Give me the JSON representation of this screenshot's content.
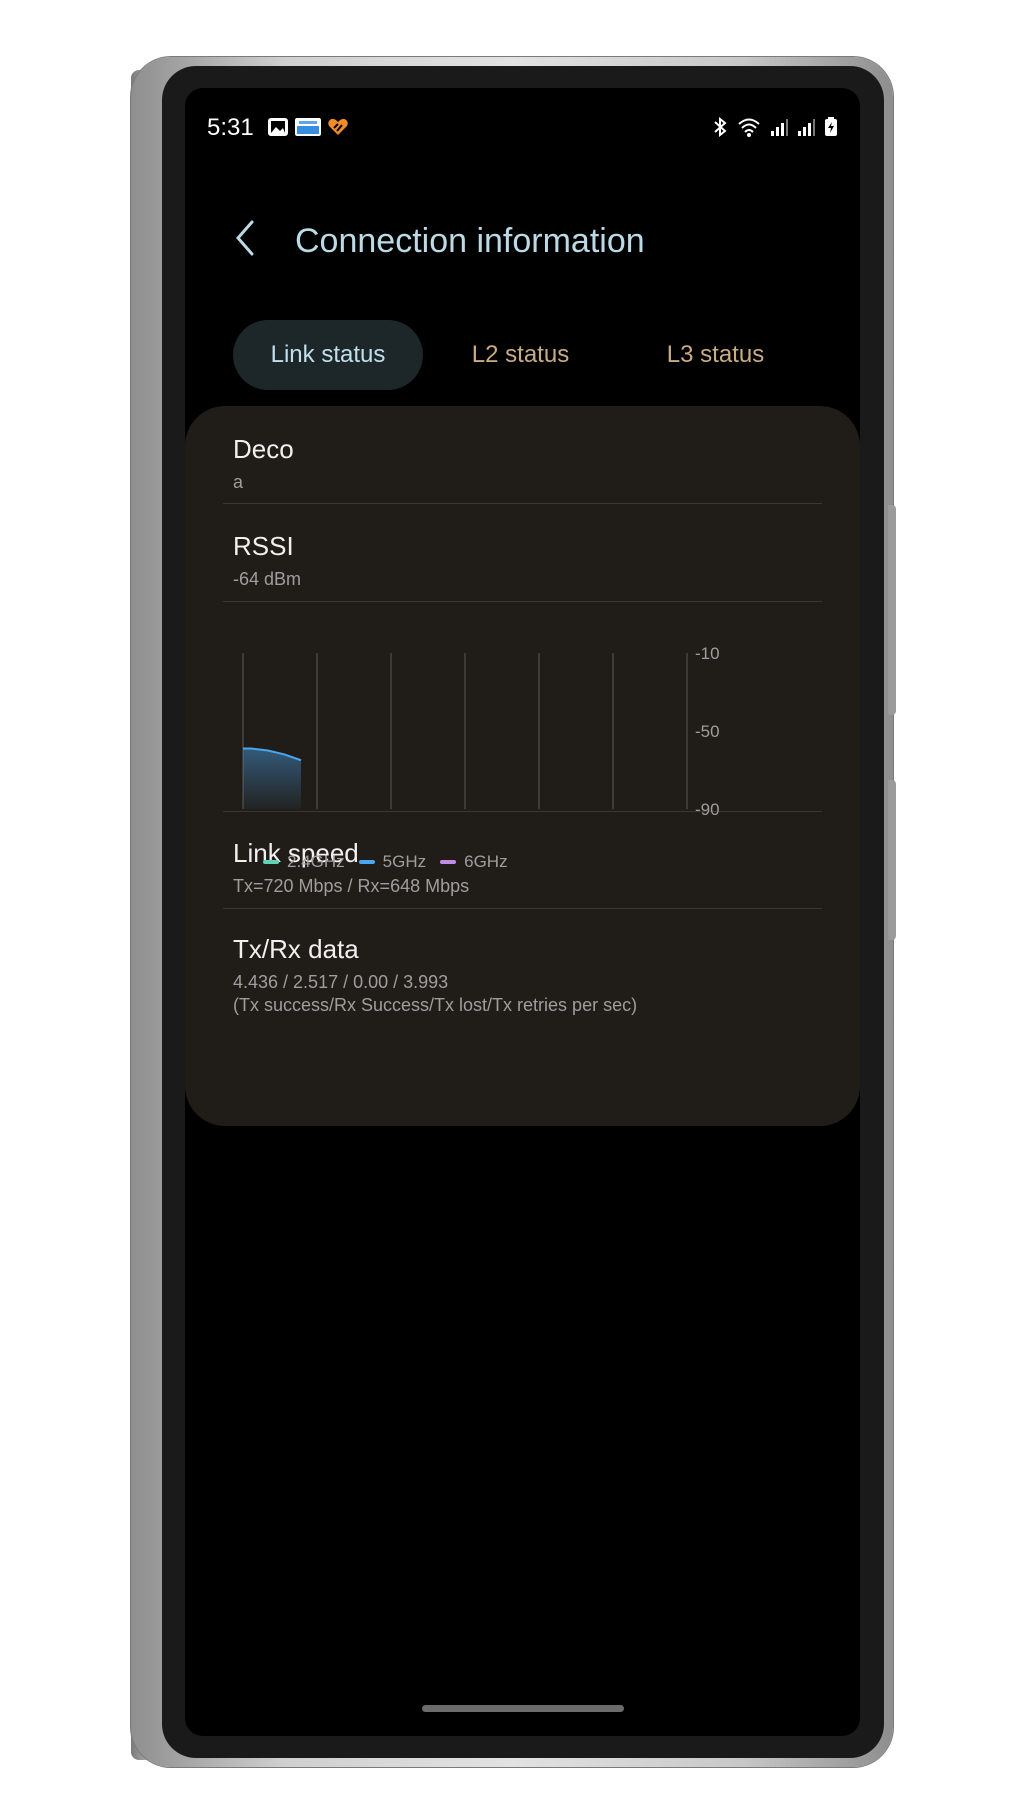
{
  "status_bar": {
    "time": "5:31"
  },
  "header": {
    "title": "Connection information"
  },
  "tabs": [
    {
      "label": "Link status",
      "active": true
    },
    {
      "label": "L2 status",
      "active": false
    },
    {
      "label": "L3 status",
      "active": false
    }
  ],
  "rows": {
    "network": {
      "title": "Deco",
      "value": "a"
    },
    "rssi": {
      "title": "RSSI",
      "value": "-64 dBm"
    },
    "link_speed": {
      "title": "Link speed",
      "value": "Tx=720 Mbps / Rx=648 Mbps"
    },
    "txrx": {
      "title": "Tx/Rx data",
      "value": "4.436 / 2.517 / 0.00 / 3.993",
      "note": "(Tx success/Rx Success/Tx lost/Tx retries per sec)"
    }
  },
  "chart_data": {
    "type": "area",
    "y_ticks": [
      "-10",
      "-50",
      "-90"
    ],
    "ylim": [
      -90,
      -10
    ],
    "grid": "vertical",
    "series": [
      {
        "name": "2.4GHz",
        "color": "#5fd3b3",
        "values": []
      },
      {
        "name": "5GHz",
        "color": "#4aa6ef",
        "values": [
          -59,
          -59,
          -59.5,
          -60,
          -61,
          -62,
          -63.5,
          -65
        ]
      },
      {
        "name": "6GHz",
        "color": "#c48be6",
        "values": []
      }
    ],
    "legend_position": "bottom-left"
  },
  "colors": {
    "accent_title": "#bcd9e6",
    "inactive_tab": "#c9ab84",
    "card_bg": "#201c18"
  }
}
